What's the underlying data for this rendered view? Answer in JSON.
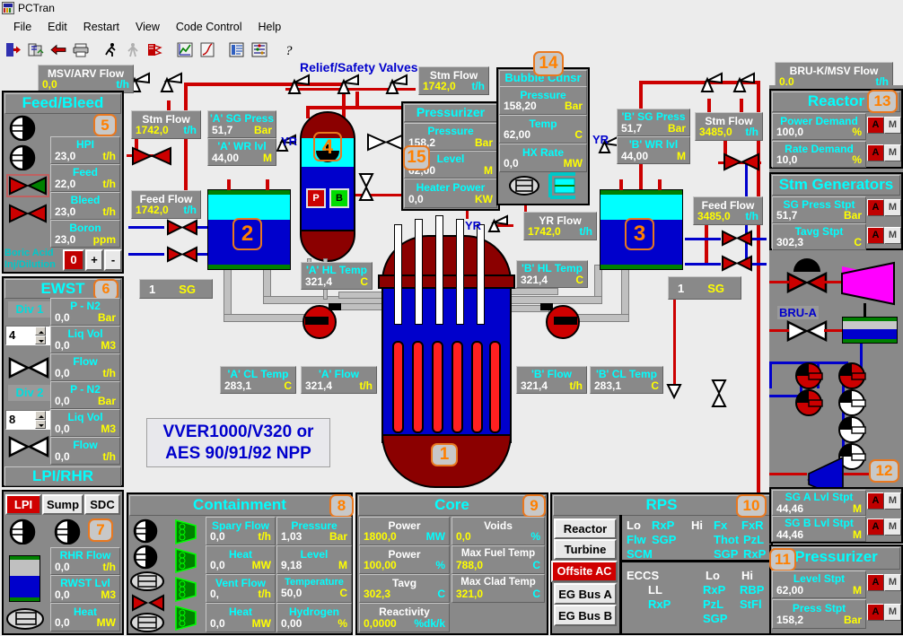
{
  "window": {
    "title": "PCTran",
    "icon": "pctran-app-icon"
  },
  "menu": [
    "File",
    "Edit",
    "Restart",
    "View",
    "Code Control",
    "Help"
  ],
  "toolbar": [
    {
      "name": "exit-icon"
    },
    {
      "name": "refresh-icon"
    },
    {
      "name": "back-arrow-icon"
    },
    {
      "name": "print-icon"
    },
    {
      "name": "run-icon"
    },
    {
      "name": "stop-icon"
    },
    {
      "name": "malfunction-icon"
    },
    {
      "name": "trend-chart-icon"
    },
    {
      "name": "graph-icon"
    },
    {
      "name": "report-icon"
    },
    {
      "name": "parameters-icon"
    },
    {
      "name": "help-icon"
    }
  ],
  "plant_title": {
    "line1": "VVER1000/V320 or",
    "line2": "AES 90/91/92 NPP"
  },
  "diagram_labels": {
    "relief_safety": "Relief/Safety Valves",
    "yr_left": "YR",
    "yr_right": "YR",
    "yr_bottom": "YR",
    "bru_a": "BRU-A"
  },
  "badges": {
    "reactor_vessel": "1",
    "sg_a": "2",
    "sg_b": "3",
    "pressurizer_vessel": "4",
    "feed_bleed": "5",
    "ewst": "6",
    "lpi_rhr": "7",
    "containment": "8",
    "core": "9",
    "rps": "10",
    "pressurizer_ctrl": "11",
    "sg_lvl_ctrl": "12",
    "reactor_ctrl": "13",
    "bubble_cdnsr": "14",
    "pressurizer": "15"
  },
  "readouts": {
    "msv_arv_flow": {
      "label": "MSV/ARV Flow",
      "value": "0,0",
      "unit": "t/h"
    },
    "bru_k_msv_flow": {
      "label": "BRU-K/MSV Flow",
      "value": "0,0",
      "unit": "t/h"
    },
    "stm_flow_a": {
      "label": "Stm Flow",
      "value": "1742,0",
      "unit": "t/h"
    },
    "feed_flow_a": {
      "label": "Feed Flow",
      "value": "1742,0",
      "unit": "t/h"
    },
    "sg_a_press": {
      "label": "'A' SG Press",
      "value": "51,7",
      "unit": "Bar"
    },
    "sg_a_wr_lvl": {
      "label": "'A' WR lvl",
      "value": "44,00",
      "unit": "M"
    },
    "stm_flow_top": {
      "label": "Stm Flow",
      "value": "1742,0",
      "unit": "t/h"
    },
    "sg_b_press": {
      "label": "'B' SG Press",
      "value": "51,7",
      "unit": "Bar"
    },
    "sg_b_wr_lvl": {
      "label": "'B' WR lvl",
      "value": "44,00",
      "unit": "M"
    },
    "stm_flow_b": {
      "label": "Stm Flow",
      "value": "3485,0",
      "unit": "t/h"
    },
    "feed_flow_b": {
      "label": "Feed Flow",
      "value": "3485,0",
      "unit": "t/h"
    },
    "hl_temp_a": {
      "label": "'A' HL Temp",
      "value": "321,4",
      "unit": "C"
    },
    "hl_temp_b": {
      "label": "'B' HL Temp",
      "value": "321,4",
      "unit": "C"
    },
    "cl_temp_a": {
      "label": "'A' CL Temp",
      "value": "283,1",
      "unit": "C"
    },
    "flow_a": {
      "label": "'A' Flow",
      "value": "321,4",
      "unit": "t/h"
    },
    "flow_b": {
      "label": "'B' Flow",
      "value": "321,4",
      "unit": "t/h"
    },
    "cl_temp_b": {
      "label": "'B' CL Temp",
      "value": "283,1",
      "unit": "C"
    },
    "yr_flow": {
      "label": "YR Flow",
      "value": "1742,0",
      "unit": "t/h"
    }
  },
  "sg_tags": {
    "left": {
      "num": "1",
      "text": "SG"
    },
    "right": {
      "num": "1",
      "text": "SG"
    }
  },
  "pressurizer_panel": {
    "title": "Pressurizer",
    "rows": [
      {
        "label": "Pressure",
        "value": "158,2",
        "unit": "Bar"
      },
      {
        "label": "Level",
        "value": "62,00",
        "unit": "M"
      },
      {
        "label": "Heater Power",
        "value": "0,0",
        "unit": "KW"
      }
    ],
    "vessel_buttons": [
      {
        "label": "P"
      },
      {
        "label": "B"
      }
    ]
  },
  "bubble_cdnsr_panel": {
    "title": "Bubble Cdnsr",
    "rows": [
      {
        "label": "Pressure",
        "value": "158,20",
        "unit": "Bar"
      },
      {
        "label": "Temp",
        "value": "62,00",
        "unit": "C"
      },
      {
        "label": "HX Rate",
        "value": "0,0",
        "unit": "MW"
      }
    ]
  },
  "feed_bleed_panel": {
    "title": "Feed/Bleed",
    "rows": [
      {
        "label": "HPI",
        "value": "23,0",
        "unit": "t/h"
      },
      {
        "label": "Feed",
        "value": "22,0",
        "unit": "t/h"
      },
      {
        "label": "Bleed",
        "value": "23,0",
        "unit": "t/h"
      },
      {
        "label": "Boron",
        "value": "23,0",
        "unit": "ppm"
      }
    ],
    "boric_acid_label": "Boric Acid\nInj/Dilution",
    "boric_acid_value": "0",
    "plus": "+",
    "minus": "-"
  },
  "ewst_panel": {
    "title": "EWST",
    "div1": "Div 1",
    "div1_count": "4",
    "div2": "Div 2",
    "div2_count": "8",
    "rows": [
      {
        "label": "P - N2",
        "value": "0,0",
        "unit": "Bar"
      },
      {
        "label": "Liq Vol",
        "value": "0,0",
        "unit": "M3"
      },
      {
        "label": "Flow",
        "value": "0,0",
        "unit": "t/h"
      },
      {
        "label": "P - N2",
        "value": "0,0",
        "unit": "Bar"
      },
      {
        "label": "Liq Vol",
        "value": "0,0",
        "unit": "M3"
      },
      {
        "label": "Flow",
        "value": "0,0",
        "unit": "t/h"
      }
    ]
  },
  "lpi_rhr_panel": {
    "title": "LPI/RHR",
    "buttons": [
      {
        "label": "LPI",
        "active": true
      },
      {
        "label": "Sump",
        "active": false
      },
      {
        "label": "SDC",
        "active": false
      }
    ],
    "rows": [
      {
        "label": "RHR Flow",
        "value": "0,0",
        "unit": "t/h"
      },
      {
        "label": "RWST Lvl",
        "value": "0,0",
        "unit": "M3"
      },
      {
        "label": "Heat",
        "value": "0,0",
        "unit": "MW"
      }
    ]
  },
  "containment_panel": {
    "title": "Containment",
    "left_rows": [
      {
        "label": "Spary Flow",
        "value": "0,0",
        "unit": "t/h"
      },
      {
        "label": "Heat",
        "value": "0,0",
        "unit": "MW"
      },
      {
        "label": "Vent Flow",
        "value": "0,",
        "unit": "t/h"
      },
      {
        "label": "Heat",
        "value": "0,0",
        "unit": "MW"
      }
    ],
    "right_rows": [
      {
        "label": "Pressure",
        "value": "1,03",
        "unit": "Bar"
      },
      {
        "label": "Level",
        "value": "9,18",
        "unit": "M"
      },
      {
        "label": "Temperature",
        "value": "50,0",
        "unit": "C"
      },
      {
        "label": "Hydrogen",
        "value": "0,00",
        "unit": "%"
      }
    ]
  },
  "core_panel": {
    "title": "Core",
    "left_rows": [
      {
        "label": "Power",
        "value": "1800,0",
        "unit": "MW"
      },
      {
        "label": "Power",
        "value": "100,00",
        "unit": "%"
      },
      {
        "label": "Tavg",
        "value": "302,3",
        "unit": "C"
      },
      {
        "label": "Reactivity",
        "value": "0,0000",
        "unit": "%dk/k"
      }
    ],
    "right_rows": [
      {
        "label": "Voids",
        "value": "0,0",
        "unit": "%"
      },
      {
        "label": "Max Fuel Temp",
        "value": "788,0",
        "unit": "C"
      },
      {
        "label": "Max Clad Temp",
        "value": "321,0",
        "unit": "C"
      }
    ]
  },
  "rps_panel": {
    "title": "RPS",
    "buttons": [
      {
        "label": "Reactor",
        "active": false
      },
      {
        "label": "Turbine",
        "active": false
      },
      {
        "label": "Offsite AC",
        "active": true
      },
      {
        "label": "EG Bus A",
        "active": false
      },
      {
        "label": "EG Bus B",
        "active": false
      }
    ],
    "trip_top": {
      "lo_header": "Lo",
      "hi_header": "Hi",
      "lo_items": [
        "RxP",
        "Flw",
        "SGP",
        "SCM"
      ],
      "hi_items": [
        "Fx",
        "FxR",
        "Thot",
        "PzL",
        "SGP",
        "RxP"
      ]
    },
    "trip_bottom": {
      "eccs": "ECCS",
      "ll": "LL",
      "ll_item": "RxP",
      "lo_header": "Lo",
      "hi_header": "Hi",
      "lo_items": [
        "RxP",
        "PzL",
        "SGP"
      ],
      "hi_items": [
        "RBP",
        "StFl"
      ]
    }
  },
  "reactor_ctrl_panel": {
    "title": "Reactor",
    "rows": [
      {
        "label": "Power Demand",
        "value": "100,0",
        "unit": "%",
        "mode_a": "A",
        "mode_m": "M"
      },
      {
        "label": "Rate Demand",
        "value": "10,0",
        "unit": "%",
        "mode_a": "A",
        "mode_m": "M"
      }
    ]
  },
  "stm_gen_panel": {
    "title": "Stm Generators",
    "rows": [
      {
        "label": "SG Press Stpt",
        "value": "51,7",
        "unit": "Bar",
        "mode_a": "A",
        "mode_m": "M"
      },
      {
        "label": "Tavg Stpt",
        "value": "302,3",
        "unit": "C",
        "mode_a": "A",
        "mode_m": "M"
      }
    ]
  },
  "sg_level_panel": {
    "rows": [
      {
        "label": "SG A Lvl Stpt",
        "value": "44,46",
        "unit": "M",
        "mode_a": "A",
        "mode_m": "M"
      },
      {
        "label": "SG B Lvl Stpt",
        "value": "44,46",
        "unit": "M",
        "mode_a": "A",
        "mode_m": "M"
      }
    ]
  },
  "pressurizer_ctrl_panel": {
    "title": "Pressurizer",
    "rows": [
      {
        "label": "Level Stpt",
        "value": "62,00",
        "unit": "M",
        "mode_a": "A",
        "mode_m": "M"
      },
      {
        "label": "Press Stpt",
        "value": "158,2",
        "unit": "Bar",
        "mode_a": "A",
        "mode_m": "M"
      }
    ]
  },
  "colors": {
    "panel_gray": "#898989",
    "label_cyan": "#00ffff",
    "value_white": "#ffffff",
    "unit_yellow": "#ffff00",
    "badge_orange": "#ff8000",
    "steam_pipe_red": "#cc0000",
    "feed_pipe_blue": "#0000cc",
    "vessel_blue": "#0000cc",
    "vessel_steam_cyan": "#00ffff",
    "vessel_dark_red": "#8b0000",
    "turbine_magenta": "#ff00ff",
    "background": "#ececec"
  }
}
